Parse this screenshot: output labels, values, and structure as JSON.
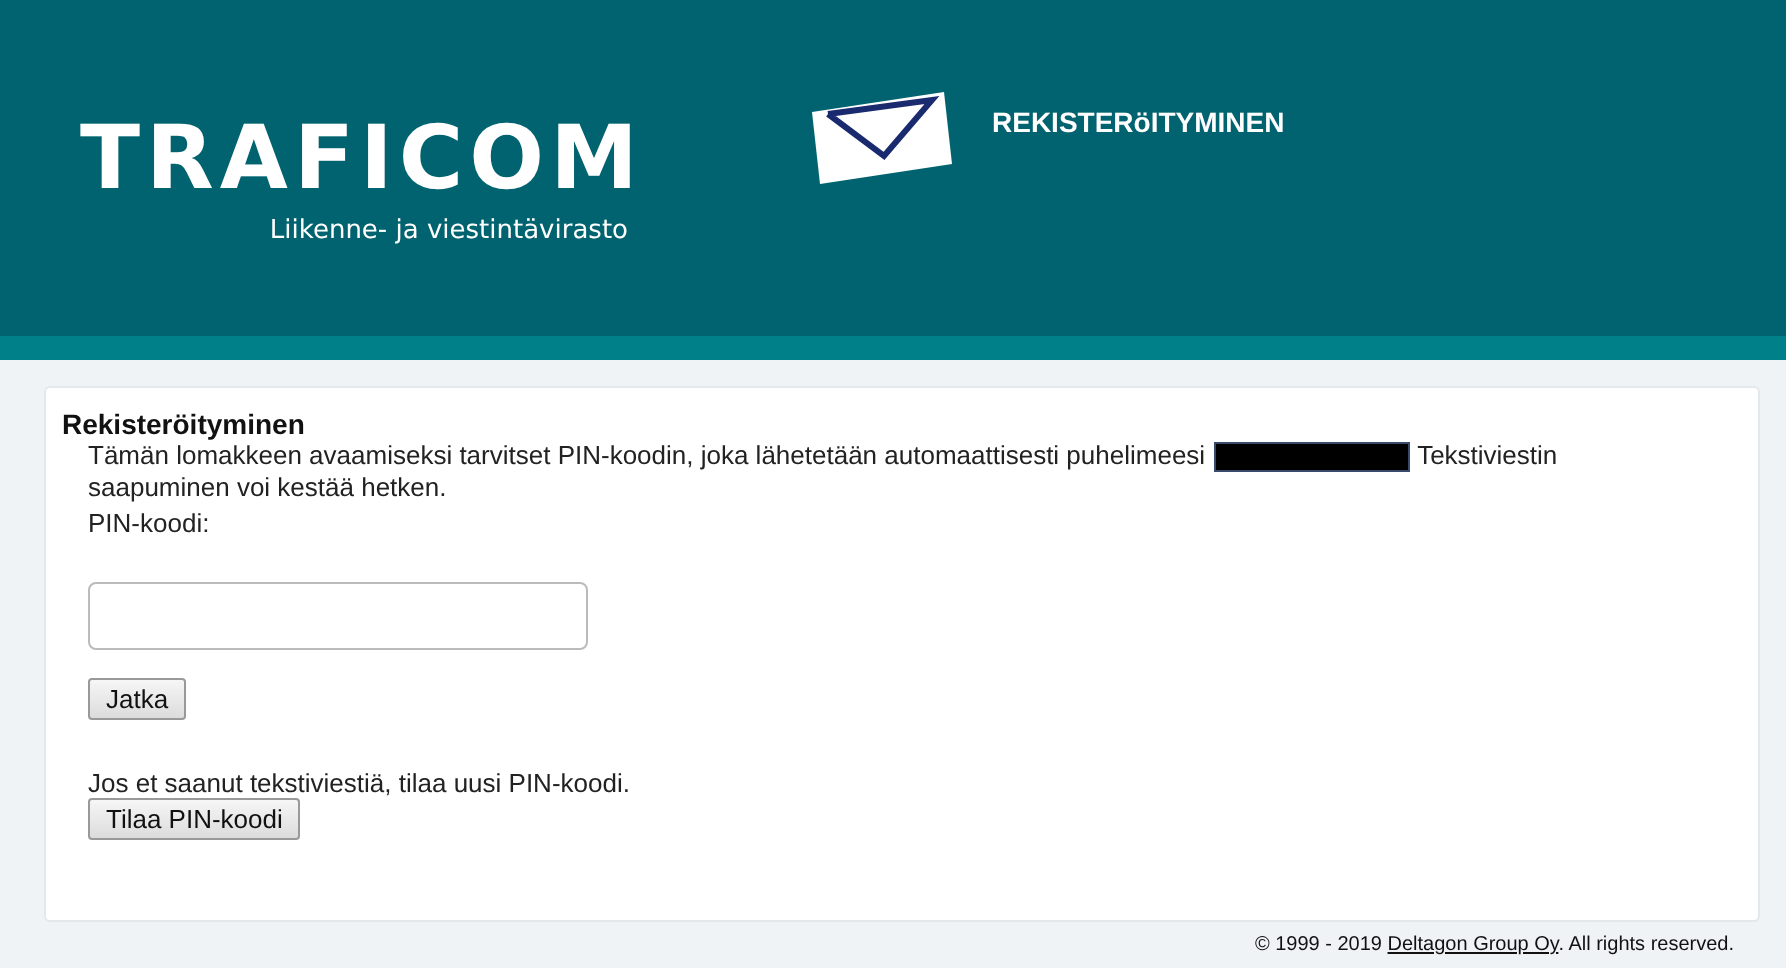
{
  "header": {
    "logo": "TRAFICOM",
    "tagline": "Liikenne- ja viestintävirasto",
    "title": "REKISTERöITYMINEN"
  },
  "form": {
    "heading": "Rekisteröityminen",
    "intro_before": "Tämän lomakkeen avaamiseksi tarvitset PIN-koodin, joka lähetetään automaattisesti puhelimeesi",
    "intro_after": [
      "Tekstiviestin",
      "saapuminen voi kestää hetken."
    ],
    "pin_label": "PIN-koodi:",
    "submit": "Jatka",
    "resend_text": "Jos et saanut tekstiviestiä, tilaa uusi PIN-koodi.",
    "resend_button": "Tilaa PIN-koodi"
  },
  "footer": {
    "prefix": "© 1999 - 2019",
    "link": "Deltagon Group Oy",
    "suffix": ". All rights reserved."
  }
}
